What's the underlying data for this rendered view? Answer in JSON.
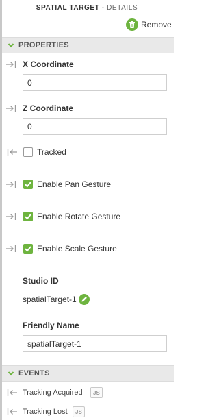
{
  "header": {
    "title_bold": "SPATIAL TARGET",
    "title_sep": " - ",
    "title_rest": "DETAILS",
    "remove_label": "Remove"
  },
  "properties": {
    "section_label": "PROPERTIES",
    "x_coordinate": {
      "label": "X Coordinate",
      "value": "0"
    },
    "z_coordinate": {
      "label": "Z Coordinate",
      "value": "0"
    },
    "tracked": {
      "label": "Tracked",
      "checked": false
    },
    "enable_pan_gesture": {
      "label": "Enable Pan Gesture",
      "checked": true
    },
    "enable_rotate_gesture": {
      "label": "Enable Rotate Gesture",
      "checked": true
    },
    "enable_scale_gesture": {
      "label": "Enable Scale Gesture",
      "checked": true
    },
    "studio_id": {
      "label": "Studio ID",
      "value": "spatialTarget-1"
    },
    "friendly_name": {
      "label": "Friendly Name",
      "value": "spatialTarget-1"
    }
  },
  "events": {
    "section_label": "EVENTS",
    "items": [
      {
        "label": "Tracking Acquired",
        "badge": "JS"
      },
      {
        "label": "Tracking Lost",
        "badge": "JS"
      }
    ]
  },
  "icons": {
    "remove": "trash-icon",
    "section_toggle": "chevron-down-icon",
    "bind_in": "bind-in-arrow-icon",
    "bind_out": "bind-out-arrow-icon",
    "checkmark": "checkmark-icon",
    "edit": "pencil-icon"
  },
  "colors": {
    "accent_green": "#6eb43f",
    "section_header_bg": "#e9e9e9",
    "binding_arrow": "#9a9a9a"
  }
}
